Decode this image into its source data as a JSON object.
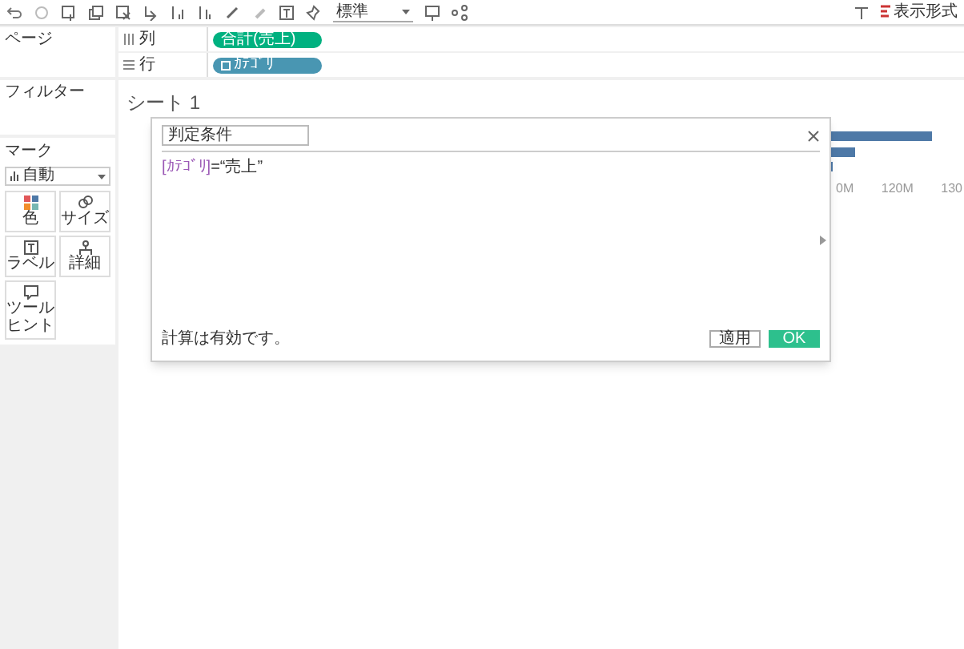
{
  "toolbar": {
    "fit_dropdown": "標準",
    "show_me": "表示形式"
  },
  "shelves": [
    {
      "kind": "columns",
      "label": "列",
      "pill": "合計(売上)",
      "color": "#00b180"
    },
    {
      "kind": "rows",
      "label": "行",
      "pill": "ｶﾃｺﾞﾘ",
      "color": "#4996b2"
    }
  ],
  "pages_panel": {
    "title": "ページ"
  },
  "filters_panel": {
    "title": "フィルター"
  },
  "marks_panel": {
    "title": "マーク",
    "mark_type": "自動",
    "cards": [
      {
        "kind": "color",
        "label": "色"
      },
      {
        "kind": "size",
        "label": "サイズ"
      },
      {
        "kind": "label",
        "label": "ラベル"
      },
      {
        "kind": "detail",
        "label": "詳細"
      },
      {
        "kind": "tooltip",
        "label": "ツールヒント"
      }
    ]
  },
  "sheet": {
    "title": "シート 1",
    "axis_labels": [
      "0M",
      "120M",
      "130"
    ]
  },
  "dialog": {
    "name_field": "判定条件",
    "formula": [
      {
        "kind": "field",
        "text": "[ｶﾃｺﾞﾘ]"
      },
      {
        "kind": "plain",
        "text": "=“売上”"
      }
    ],
    "status": "計算は有効です。",
    "buttons": [
      {
        "kind": "secondary",
        "label": "適用"
      },
      {
        "kind": "primary",
        "label": "OK"
      }
    ]
  }
}
